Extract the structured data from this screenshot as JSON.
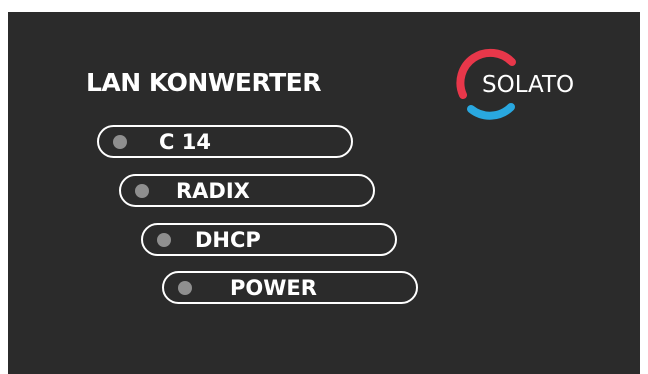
{
  "header": {
    "title": "LAN KONWERTER"
  },
  "logo": {
    "text": "SOLATO",
    "colors": {
      "arc_top": "#e8374a",
      "arc_bottom": "#29a8e0"
    }
  },
  "indicators": [
    {
      "label": "C 14",
      "led_color": "#8f8f8f"
    },
    {
      "label": "RADIX",
      "led_color": "#8f8f8f"
    },
    {
      "label": "DHCP",
      "led_color": "#8f8f8f"
    },
    {
      "label": "POWER",
      "led_color": "#8f8f8f"
    }
  ],
  "colors": {
    "background": "#2b2b2b",
    "foreground": "#ffffff"
  }
}
